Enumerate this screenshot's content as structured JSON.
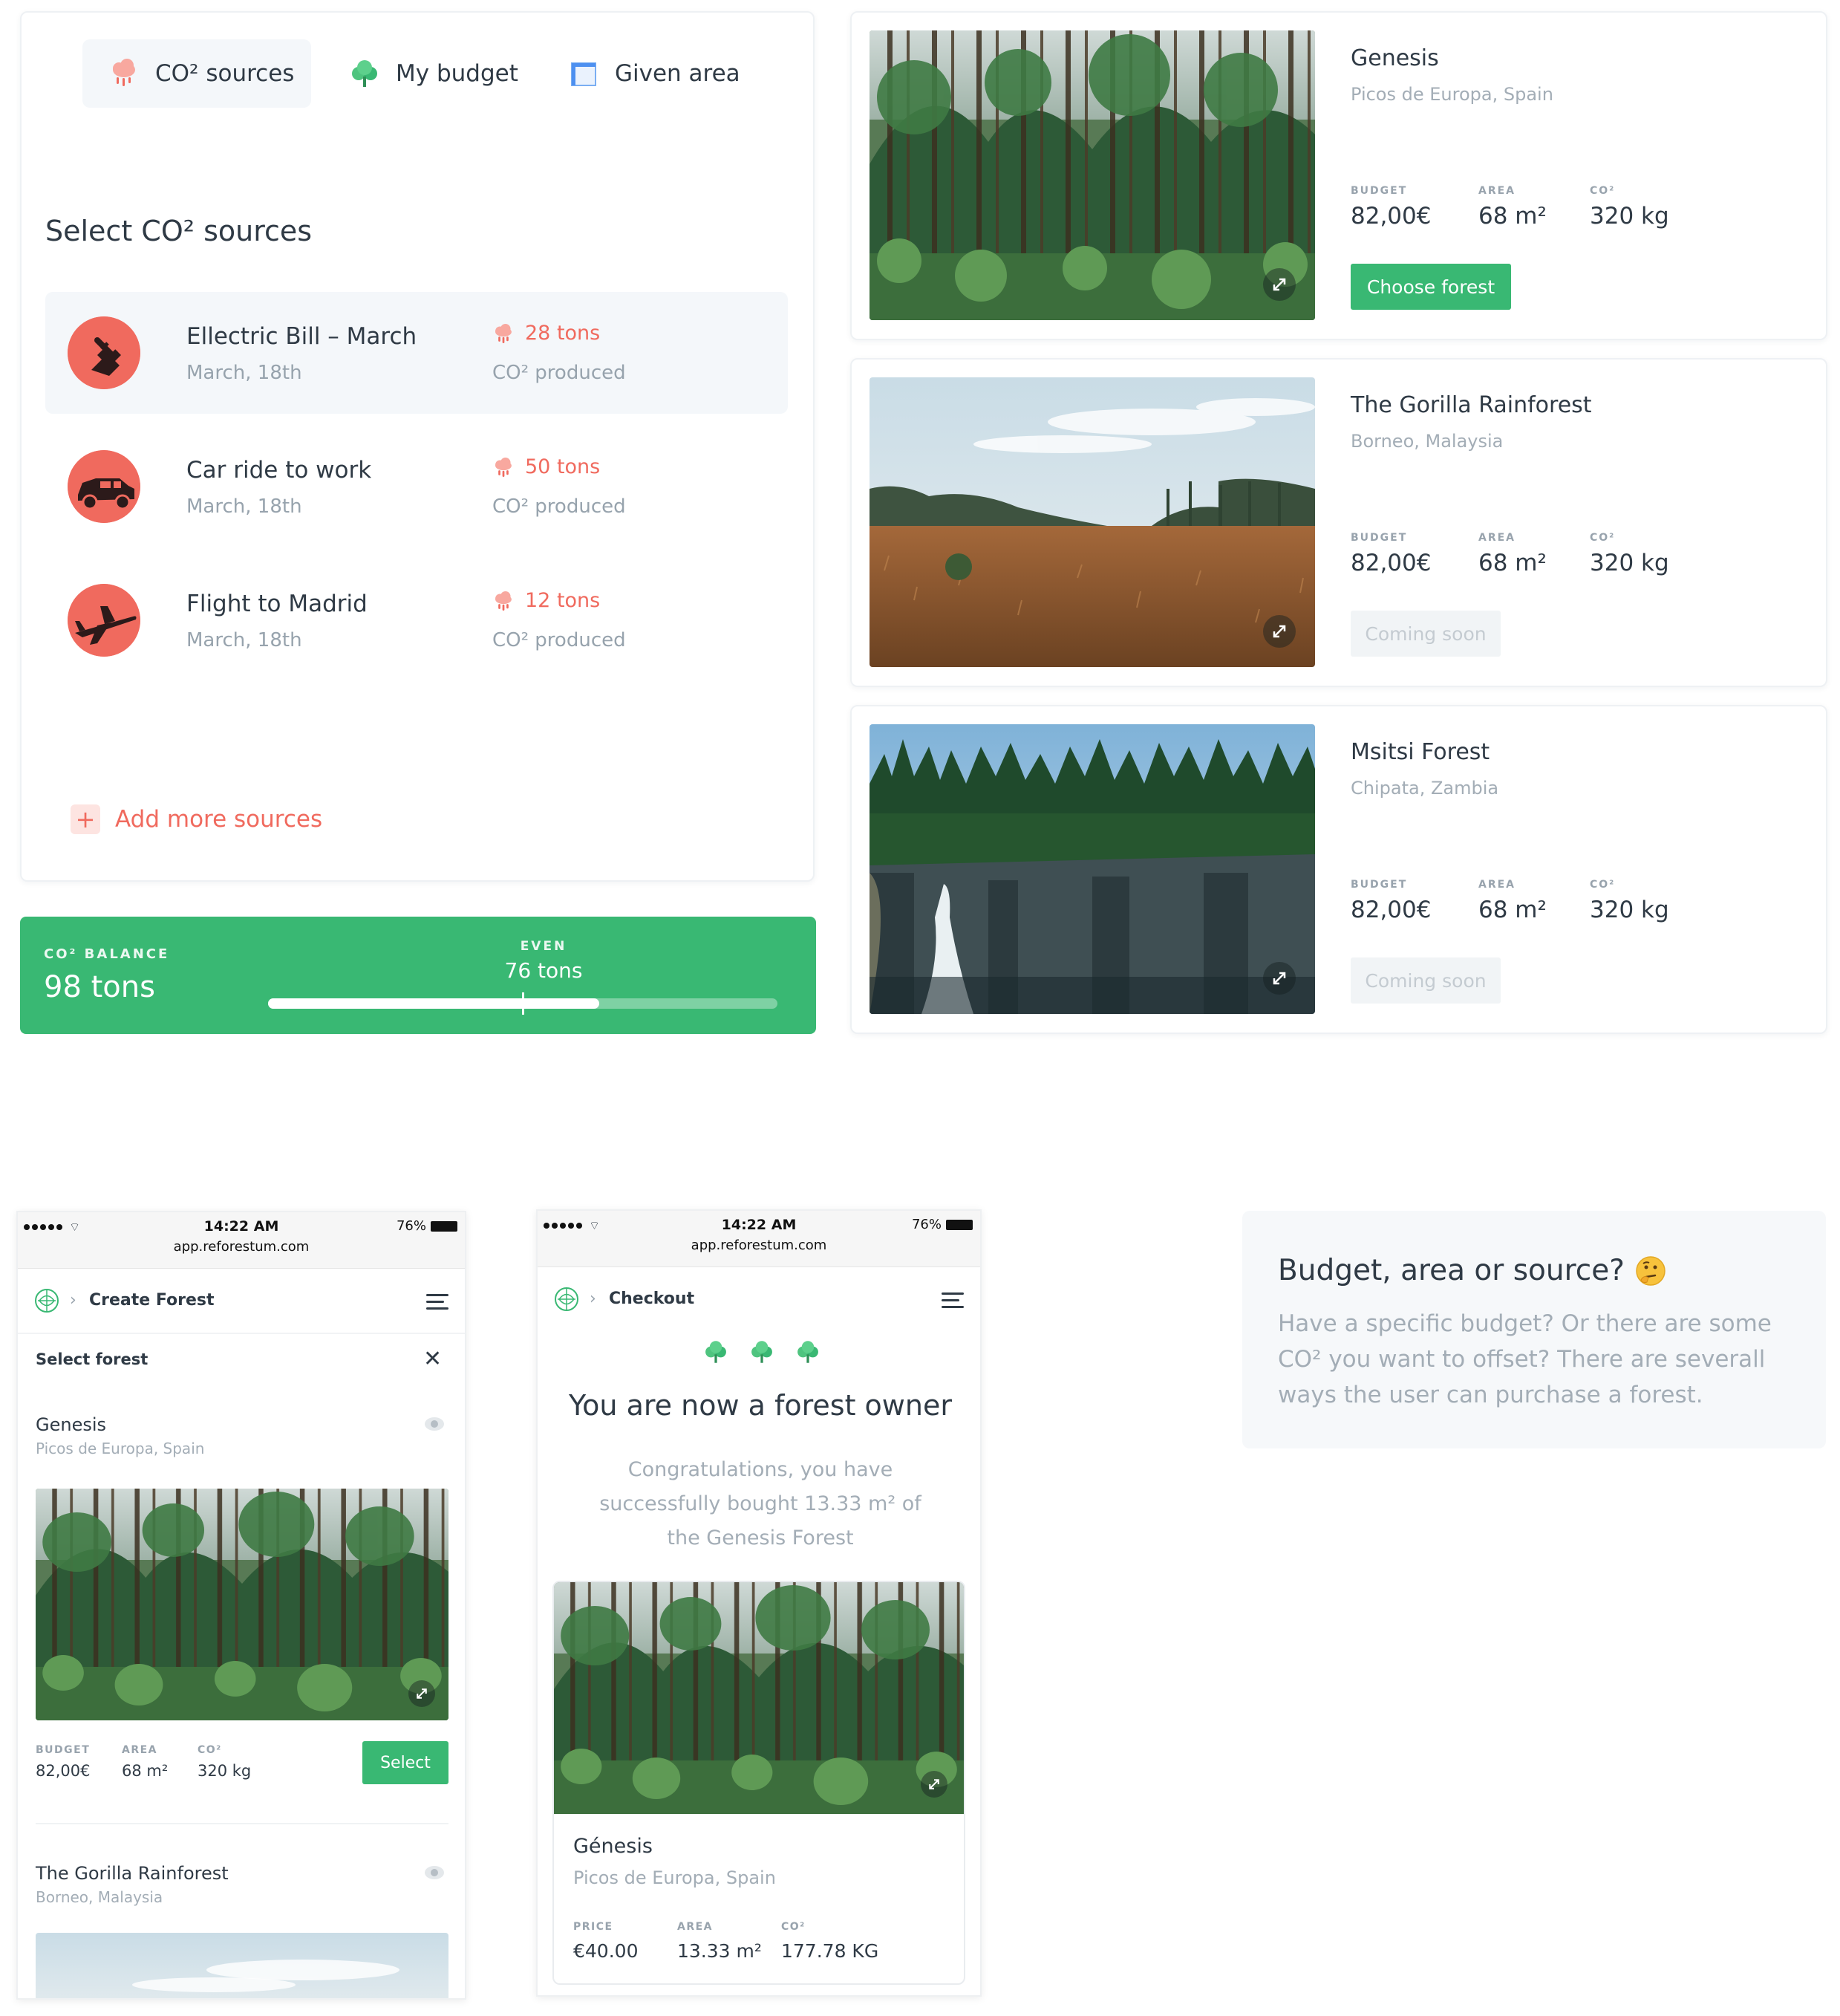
{
  "tabs": [
    {
      "label": "CO² sources",
      "icon": "cloud-rain-icon"
    },
    {
      "label": "My budget",
      "icon": "trees-icon"
    },
    {
      "label": "Given area",
      "icon": "area-icon"
    }
  ],
  "sources_panel": {
    "heading": "Select CO² sources",
    "items": [
      {
        "title": "Ellectric Bill – March",
        "date": "March, 18th",
        "tons": "28 tons",
        "produced": "CO² produced",
        "icon": "plug-icon"
      },
      {
        "title": "Car ride to work",
        "date": "March, 18th",
        "tons": "50 tons",
        "produced": "CO² produced",
        "icon": "car-icon"
      },
      {
        "title": "Flight to Madrid",
        "date": "March, 18th",
        "tons": "12 tons",
        "produced": "CO² produced",
        "icon": "airplane-icon"
      }
    ],
    "add_more": "Add more sources"
  },
  "balance": {
    "label": "CO² BALANCE",
    "value": "98 tons",
    "even_label": "EVEN",
    "even_value": "76 tons",
    "progress": 0.65,
    "marker": 0.5
  },
  "forests": [
    {
      "name": "Genesis",
      "location": "Picos de Europa, Spain",
      "budget_label": "BUDGET",
      "budget": "82,00€",
      "area_label": "AREA",
      "area": "68 m²",
      "co2_label": "CO²",
      "co2": "320 kg",
      "button": "Choose forest",
      "button_state": "active"
    },
    {
      "name": "The Gorilla Rainforest",
      "location": "Borneo, Malaysia",
      "budget_label": "BUDGET",
      "budget": "82,00€",
      "area_label": "AREA",
      "area": "68 m²",
      "co2_label": "CO²",
      "co2": "320 kg",
      "button": "Coming soon",
      "button_state": "disabled"
    },
    {
      "name": "Msitsi Forest",
      "location": "Chipata, Zambia",
      "budget_label": "BUDGET",
      "budget": "82,00€",
      "area_label": "AREA",
      "area": "68 m²",
      "co2_label": "CO²",
      "co2": "320 kg",
      "button": "Coming soon",
      "button_state": "disabled"
    }
  ],
  "phone1": {
    "time": "14:22 AM",
    "url": "app.reforestum.com",
    "battery": "76%",
    "breadcrumb": "Create Forest",
    "section_title": "Select forest",
    "items": [
      {
        "name": "Genesis",
        "location": "Picos de Europa, Spain",
        "budget_label": "BUDGET",
        "budget": "82,00€",
        "area_label": "AREA",
        "area": "68 m²",
        "co2_label": "CO²",
        "co2": "320 kg",
        "button": "Select"
      },
      {
        "name": "The Gorilla Rainforest",
        "location": "Borneo, Malaysia"
      }
    ]
  },
  "phone2": {
    "time": "14:22 AM",
    "url": "app.reforestum.com",
    "battery": "76%",
    "breadcrumb": "Checkout",
    "headline": "You are now a forest owner",
    "message_lines": [
      "Congratulations, you have",
      "successfully bought 13.33 m² of",
      "the Genesis Forest"
    ],
    "card": {
      "name": "Génesis",
      "location": "Picos de Europa, Spain",
      "price_label": "PRICE",
      "price": "€40.00",
      "area_label": "AREA",
      "area": "13.33 m²",
      "co2_label": "CO²",
      "co2": "177.78 KG"
    }
  },
  "info_card": {
    "title": "Budget, area or source?",
    "emoji": "🤔",
    "body_lines": [
      "Have a specific budget? Or there are some",
      "CO² you want to offset? There are severall",
      "ways the user can purchase a forest."
    ]
  },
  "colors": {
    "green": "#39b873",
    "coral": "#f06a5e",
    "text": "#2f3a45",
    "muted": "#97a3ad"
  }
}
